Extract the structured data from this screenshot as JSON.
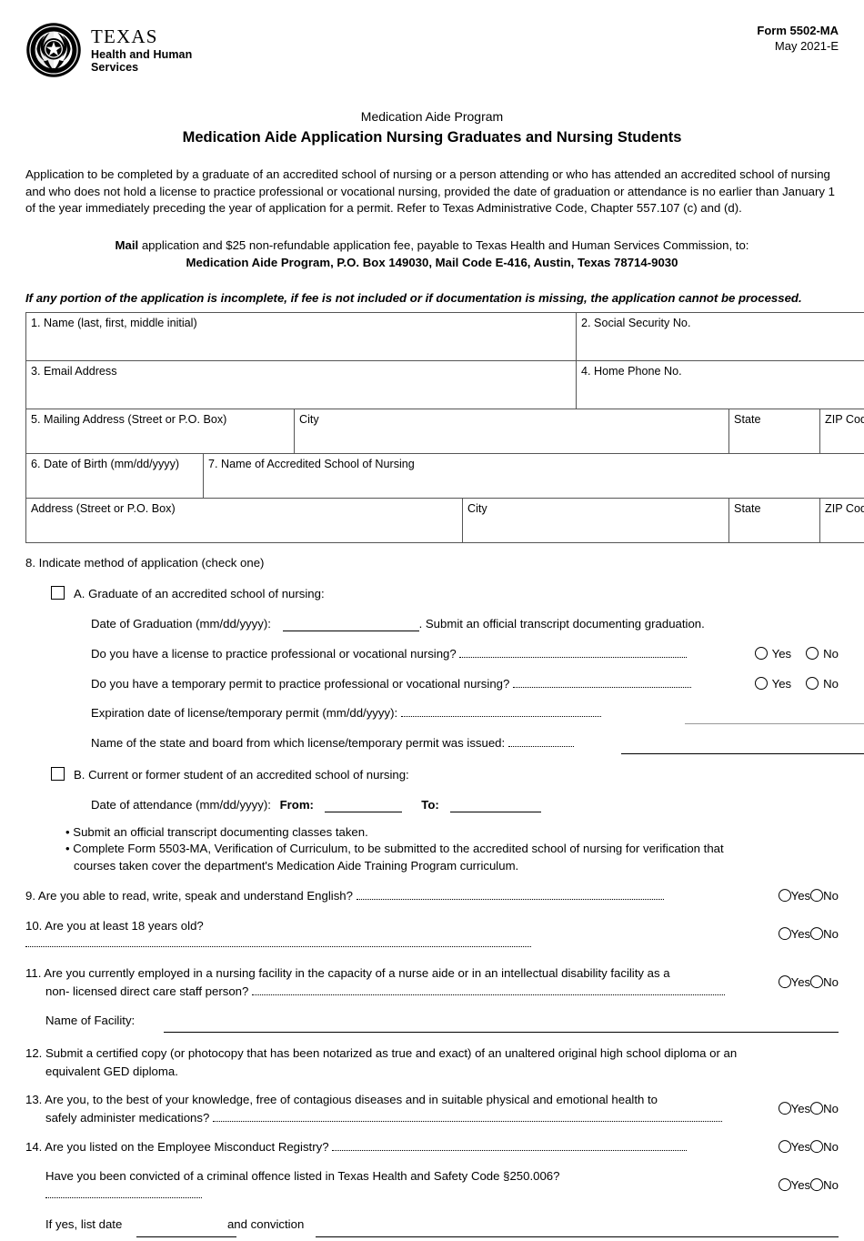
{
  "header": {
    "agency_name": "TEXAS",
    "agency_sub_line1": "Health and Human",
    "agency_sub_line2": "Services",
    "form_number": "Form 5502-MA",
    "form_date": "May 2021-E"
  },
  "titles": {
    "program": "Medication Aide Program",
    "main": "Medication Aide Application Nursing Graduates and Nursing Students"
  },
  "intro_paragraph": "Application to be completed by a graduate of an accredited school of nursing or a person attending or who has attended an accredited school of nursing and who does not hold a license to practice professional or vocational nursing, provided the date of graduation or attendance is no earlier than January 1 of the year immediately preceding the year of application for a permit. Refer to Texas Administrative Code, Chapter 557.107 (c) and (d).",
  "mail_block": {
    "bold_lead": "Mail",
    "line1_rest": " application and $25 non-refundable application fee, payable to Texas Health and Human Services Commission, to:",
    "line2": "Medication Aide Program, P.O. Box 149030, Mail Code E-416, Austin, Texas 78714-9030"
  },
  "warning": "If any portion of the application is incomplete, if fee is not included or if documentation is missing, the application cannot be processed.",
  "grid": {
    "name": "1. Name (last, first, middle initial)",
    "ssn": "2. Social Security No.",
    "email": "3. Email Address",
    "phone": "4. Home Phone No.",
    "mailing_address": "5. Mailing Address (Street or P.O. Box)",
    "city1": "City",
    "state1": "State",
    "zip1": "ZIP Code",
    "dob": "6. Date of Birth (mm/dd/yyyy)",
    "school_name": "7. Name of Accredited School of Nursing",
    "school_address": "Address (Street or P.O. Box)",
    "city2": "City",
    "state2": "State",
    "zip2": "ZIP Code"
  },
  "q8": {
    "heading": "8. Indicate method of application (check one)",
    "option_a": "A. Graduate of an accredited school of nursing:",
    "grad_date_label": "Date of Graduation (mm/dd/yyyy):",
    "grad_date_after": ". Submit an official transcript documenting graduation.",
    "license_q": "Do you have a license to practice professional or vocational nursing?",
    "temp_permit_q": "Do you have a temporary permit to practice professional or vocational nursing?",
    "expiration_label": "Expiration date of license/temporary permit (mm/dd/yyyy):",
    "state_board_label": "Name of the state and board from which license/temporary permit was issued:",
    "option_b": "B. Current or former student of an accredited school of nursing:",
    "attendance_label": "Date of attendance (mm/dd/yyyy):",
    "from_label": "From:",
    "to_label": "To:",
    "bullet1": "• Submit an official transcript documenting classes taken.",
    "bullet2_line1": "• Complete Form 5503-MA, Verification of Curriculum, to be submitted to the accredited school of nursing for verification that",
    "bullet2_line2": "courses taken cover the department's Medication Aide Training Program curriculum."
  },
  "q9": {
    "text": "9. Are you able to read, write, speak and understand English?"
  },
  "q10": {
    "text": "10. Are you at least 18 years old?"
  },
  "q11": {
    "line1": "11. Are you currently employed in a nursing facility in the capacity of a nurse aide or in an intellectual disability facility as a",
    "line2": "non- licensed direct care staff person?",
    "facility_label": "Name of Facility:"
  },
  "q12": {
    "line1": "12. Submit a certified copy (or photocopy that has been notarized as true and exact) of an unaltered original high school diploma or an",
    "line2": "equivalent GED diploma."
  },
  "q13": {
    "line1": "13. Are you, to the best of your knowledge, free of contagious diseases and in suitable physical and emotional health to",
    "line2": "safely administer medications?"
  },
  "q14": {
    "text": "14. Are you listed on the Employee Misconduct Registry?",
    "conviction_q": "Have you been convicted of a criminal offence listed in Texas Health and Safety Code §250.006?",
    "if_yes_label": "If yes, list date",
    "and_conviction_label": "and conviction"
  },
  "radio": {
    "yes": "Yes",
    "no": "No"
  },
  "colors": {
    "text": "#000000",
    "rule": "#000000",
    "rule_light": "#999999",
    "grid_border": "#555555"
  }
}
